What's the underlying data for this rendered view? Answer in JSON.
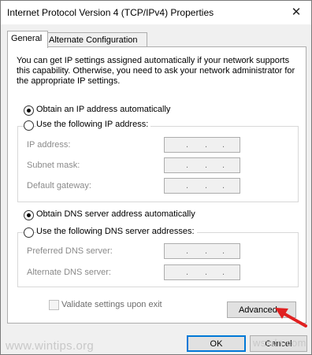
{
  "window": {
    "title": "Internet Protocol Version 4 (TCP/IPv4) Properties",
    "close_glyph": "✕"
  },
  "tabs": [
    {
      "label": "General",
      "active": true
    },
    {
      "label": "Alternate Configuration",
      "active": false
    }
  ],
  "description": "You can get IP settings assigned automatically if your network supports this capability. Otherwise, you need to ask your network administrator for the appropriate IP settings.",
  "ip": {
    "auto_label": "Obtain an IP address automatically",
    "manual_label": "Use the following IP address:",
    "selected": "auto",
    "fields": [
      {
        "label": "IP address:"
      },
      {
        "label": "Subnet mask:"
      },
      {
        "label": "Default gateway:"
      }
    ]
  },
  "dns": {
    "auto_label": "Obtain DNS server address automatically",
    "manual_label": "Use the following DNS server addresses:",
    "selected": "auto",
    "fields": [
      {
        "label": "Preferred DNS server:"
      },
      {
        "label": "Alternate DNS server:"
      }
    ]
  },
  "validate_label": "Validate settings upon exit",
  "buttons": {
    "advanced": "Advanced...",
    "ok": "OK",
    "cancel": "Cancel"
  },
  "watermarks": {
    "left": "www.wintips.org",
    "right": "wsxdn.com"
  },
  "colors": {
    "arrow": "#e02020",
    "ok_border": "#0078d7"
  }
}
